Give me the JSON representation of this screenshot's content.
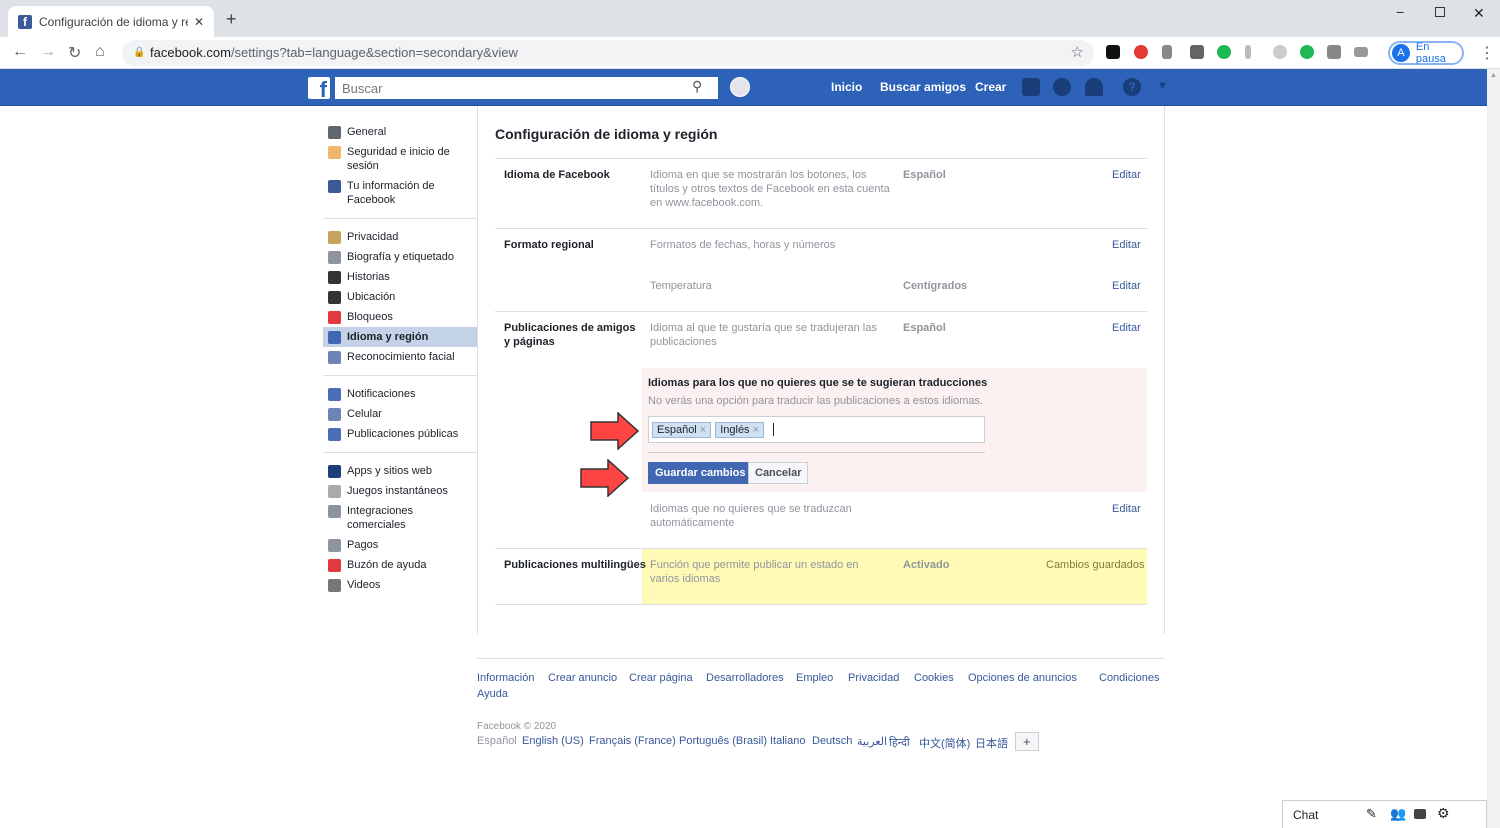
{
  "browser": {
    "tab_title": "Configuración de idioma y regió",
    "url_domain": "facebook.com",
    "url_path": "/settings?tab=language&section=secondary&view",
    "profile_initial": "A",
    "profile_status": "En pausa"
  },
  "fb": {
    "search_placeholder": "Buscar",
    "nav": [
      "Inicio",
      "Buscar amigos",
      "Crear"
    ],
    "brand_color": "#2d62b8"
  },
  "sidebar": {
    "groups": [
      [
        {
          "label": "General",
          "icon": "gears-icon",
          "color": "#606770"
        },
        {
          "label": "Seguridad e inicio de sesión",
          "icon": "badge-icon",
          "color": "#f0b76a"
        },
        {
          "label": "Tu información de Facebook",
          "icon": "facebook-icon",
          "color": "#3b5998"
        }
      ],
      [
        {
          "label": "Privacidad",
          "icon": "lock-icon",
          "color": "#c9a45c"
        },
        {
          "label": "Biografía y etiquetado",
          "icon": "timeline-icon",
          "color": "#8d949e"
        },
        {
          "label": "Historias",
          "icon": "book-icon",
          "color": "#333"
        },
        {
          "label": "Ubicación",
          "icon": "location-icon",
          "color": "#333"
        },
        {
          "label": "Bloqueos",
          "icon": "block-icon",
          "color": "#e0393e"
        },
        {
          "label": "Idioma y región",
          "icon": "language-icon",
          "color": "#4267b2",
          "active": true
        },
        {
          "label": "Reconocimiento facial",
          "icon": "face-icon",
          "color": "#6d84b4"
        }
      ],
      [
        {
          "label": "Notificaciones",
          "icon": "globe-icon",
          "color": "#4b6cb7"
        },
        {
          "label": "Celular",
          "icon": "phone-icon",
          "color": "#6d84b4"
        },
        {
          "label": "Publicaciones públicas",
          "icon": "rss-icon",
          "color": "#4b6cb7"
        }
      ],
      [
        {
          "label": "Apps y sitios web",
          "icon": "apps-icon",
          "color": "#1c3f7a"
        },
        {
          "label": "Juegos instantáneos",
          "icon": "gamepad-icon",
          "color": "#aaa"
        },
        {
          "label": "Integraciones comerciales",
          "icon": "business-icon",
          "color": "#8d949e"
        },
        {
          "label": "Pagos",
          "icon": "card-icon",
          "color": "#8d949e"
        },
        {
          "label": "Buzón de ayuda",
          "icon": "lifebuoy-icon",
          "color": "#e0393e"
        },
        {
          "label": "Videos",
          "icon": "film-icon",
          "color": "#777"
        }
      ]
    ]
  },
  "main": {
    "title": "Configuración de idioma y región",
    "edit": "Editar",
    "rows": {
      "fb_lang": {
        "label": "Idioma de Facebook",
        "desc": "Idioma en que se mostrarán los botones, los títulos y otros textos de Facebook en esta cuenta en www.facebook.com.",
        "value": "Español"
      },
      "regional": {
        "label": "Formato regional",
        "desc": "Formatos de fechas, horas y números",
        "temp_desc": "Temperatura",
        "temp_value": "Centígrados"
      },
      "friends": {
        "label": "Publicaciones de amigos y páginas",
        "desc": "Idioma al que te gustaría que se tradujeran las publicaciones",
        "value": "Español",
        "panel_title": "Idiomas para los que no quieres que se te sugieran traducciones",
        "panel_desc": "No verás una opción para traducir las publicaciones a estos idiomas.",
        "tags": [
          "Español",
          "Inglés"
        ],
        "save": "Guardar cambios",
        "cancel": "Cancelar",
        "no_auto_desc": "Idiomas que no quieres que se traduzcan automáticamente"
      },
      "multi": {
        "label": "Publicaciones multilingües",
        "desc": "Función que permite publicar un estado en varios idiomas",
        "value": "Activado",
        "status": "Cambios guardados"
      }
    }
  },
  "footer": {
    "links": [
      "Información",
      "Crear anuncio",
      "Crear página",
      "Desarrolladores",
      "Empleo",
      "Privacidad",
      "Cookies",
      "Opciones de anuncios",
      "Condiciones",
      "Ayuda"
    ],
    "copyright": "Facebook © 2020",
    "current_lang": "Español",
    "langs": [
      "English (US)",
      "Français (France)",
      "Português (Brasil)",
      "Italiano",
      "Deutsch",
      "العربية",
      "हिन्दी",
      "中文(简体)",
      "日本語"
    ],
    "more": "+"
  },
  "chat": {
    "label": "Chat"
  }
}
